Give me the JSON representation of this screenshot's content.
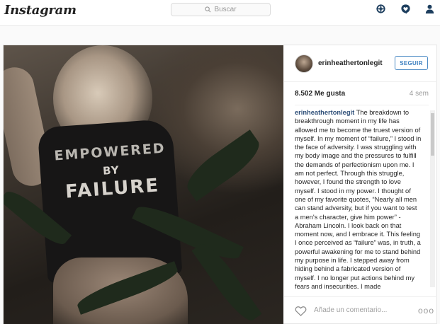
{
  "app": {
    "logo": "Instagram"
  },
  "search": {
    "placeholder": "Buscar"
  },
  "nav": {
    "icons": [
      "explore-icon",
      "activity-icon",
      "profile-icon"
    ]
  },
  "post": {
    "username": "erinheathertonlegit",
    "follow_label": "SEGUIR",
    "likes": "8.502 Me gusta",
    "time": "4 sem",
    "caption_user": "erinheathertonlegit",
    "caption_text": "The breakdown to breakthrough moment in my life has allowed me to become the truest version of myself. In my moment of “failure,” I stood in the face of adversity. I was struggling with my body image and the pressures to fulfill the demands of perfectionism upon me. I am not perfect. Through this struggle, however, I found the strength to love myself. I stood in my power. I thought of one of my favorite quotes, “Nearly all men can stand adversity, but if you want to test a men's character, give him power” - Abraham Lincoln. I look back on that moment now, and I embrace it. This feeling I once perceived as “failure” was, in truth, a powerful awakening for me to stand behind my purpose in life. I stepped away from hiding behind a fabricated version of myself. I no longer put actions behind my fears and insecurities. I made",
    "shirt_text": [
      "EMPOWERED",
      "BY",
      "FAILURE"
    ],
    "comment_placeholder": "Añade un comentario...",
    "more_label": "ooo"
  },
  "colors": {
    "accent": "#3c7fbf",
    "border": "#e6e6e6",
    "username_link": "#2d4e78"
  }
}
